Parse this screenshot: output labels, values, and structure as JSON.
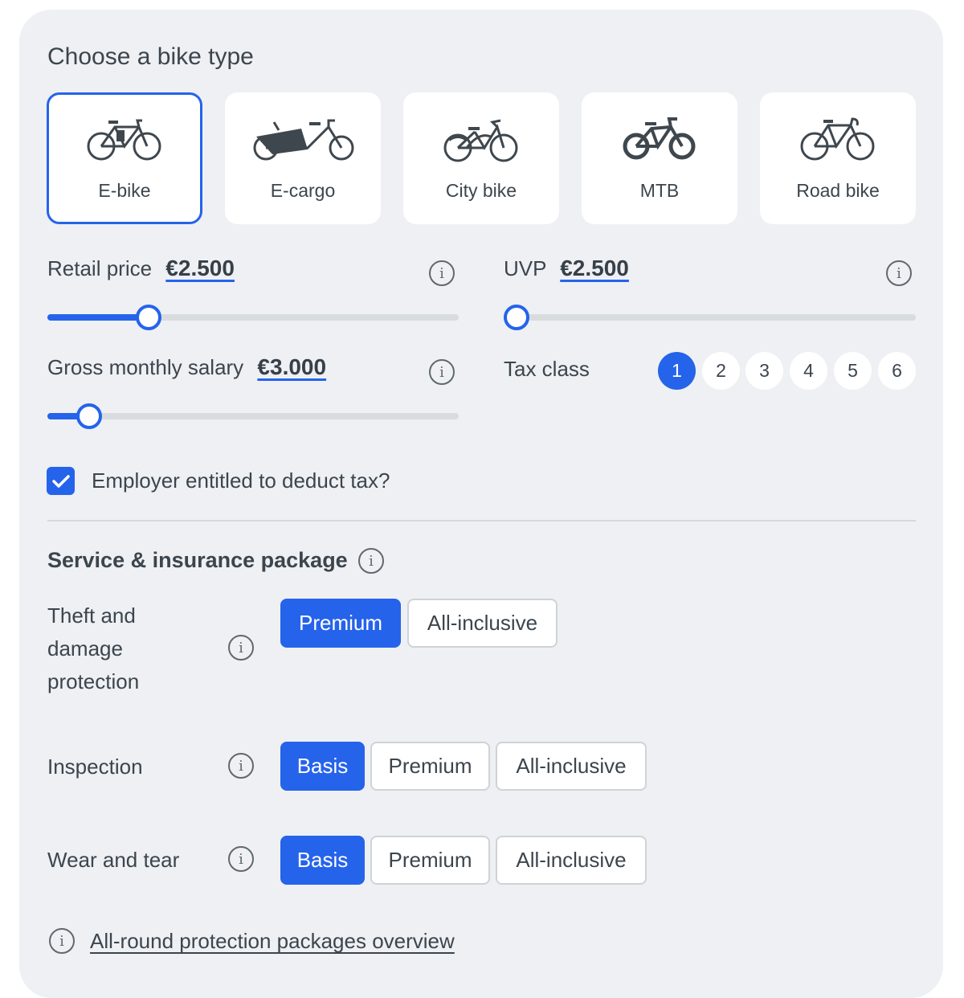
{
  "header": {
    "title": "Choose a bike type"
  },
  "bike_types": [
    {
      "label": "E-bike",
      "icon": "e-bike-icon",
      "selected": true
    },
    {
      "label": "E-cargo",
      "icon": "e-cargo-icon",
      "selected": false
    },
    {
      "label": "City bike",
      "icon": "city-bike-icon",
      "selected": false
    },
    {
      "label": "MTB",
      "icon": "mtb-icon",
      "selected": false
    },
    {
      "label": "Road bike",
      "icon": "road-bike-icon",
      "selected": false
    }
  ],
  "retail_price": {
    "label": "Retail price",
    "value": "€2.500",
    "slider_fraction": 0.23
  },
  "uvp": {
    "label": "UVP",
    "value": "€2.500",
    "slider_fraction": 0.0
  },
  "salary": {
    "label": "Gross monthly salary",
    "value": "€3.000",
    "slider_fraction": 0.075
  },
  "tax_class": {
    "label": "Tax class",
    "options": [
      "1",
      "2",
      "3",
      "4",
      "5",
      "6"
    ],
    "selected": "1"
  },
  "employer_deduct": {
    "label": "Employer entitled to deduct tax?",
    "checked": true
  },
  "package": {
    "title": "Service & insurance package",
    "rows": [
      {
        "label": "Theft and damage protection",
        "options": [
          "Premium",
          "All-inclusive"
        ],
        "selected": "Premium"
      },
      {
        "label": "Inspection",
        "options": [
          "Basis",
          "Premium",
          "All-inclusive"
        ],
        "selected": "Basis"
      },
      {
        "label": "Wear and tear",
        "options": [
          "Basis",
          "Premium",
          "All-inclusive"
        ],
        "selected": "Basis"
      }
    ]
  },
  "overview_link": "All-round protection packages overview",
  "colors": {
    "accent": "#2563eb",
    "panel": "#eef0f3",
    "text": "#3c454d"
  }
}
